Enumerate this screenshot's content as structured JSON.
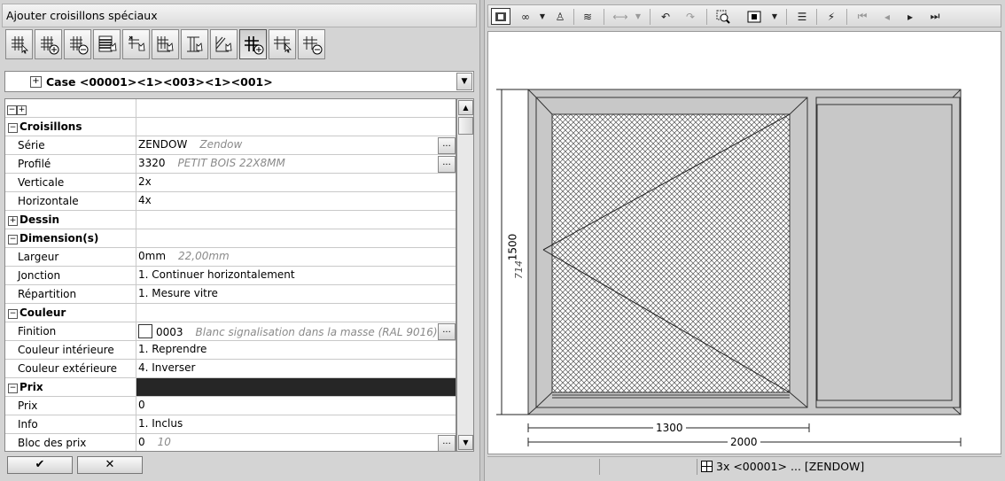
{
  "window_title": "Ajouter croisillons spéciaux",
  "case_label": "Case <00001><1><003><1><001>",
  "sections": {
    "croisillons": "Croisillons",
    "dessin": "Dessin",
    "dimensions": "Dimension(s)",
    "couleur": "Couleur",
    "prix": "Prix"
  },
  "props": {
    "serie": {
      "label": "Série",
      "value": "ZENDOW",
      "desc": "Zendow"
    },
    "profile": {
      "label": "Profilé",
      "value": "3320",
      "desc": "PETIT BOIS 22X8MM"
    },
    "verticale": {
      "label": "Verticale",
      "value": "2x"
    },
    "horizontale": {
      "label": "Horizontale",
      "value": "4x"
    },
    "largeur": {
      "label": "Largeur",
      "value": "0mm",
      "desc": "22,00mm"
    },
    "jonction": {
      "label": "Jonction",
      "value": "1. Continuer horizontalement"
    },
    "repartition": {
      "label": "Répartition",
      "value": "1. Mesure vitre"
    },
    "finition": {
      "label": "Finition",
      "value": "0003",
      "desc": "Blanc signalisation dans la masse (RAL 9016)"
    },
    "couleur_int": {
      "label": "Couleur intérieure",
      "value": "1. Reprendre"
    },
    "couleur_ext": {
      "label": "Couleur extérieure",
      "value": "4. Inverser"
    },
    "prix": {
      "label": "Prix",
      "value": "0"
    },
    "info": {
      "label": "Info",
      "value": "1. Inclus"
    },
    "bloc_prix": {
      "label": "Bloc des prix",
      "value": "0",
      "desc": "10"
    }
  },
  "buttons": {
    "ok": "✔",
    "cancel": "✕"
  },
  "drawing": {
    "dim_height": "1500",
    "dim_sub": "714",
    "dim_width_left": "1300",
    "dim_width_total": "2000"
  },
  "status_text": "3x <00001> ... [ZENDOW]",
  "colors": {
    "panel": "#d4d4d4",
    "frame_fill": "#c8c8c8",
    "prix_bar": "#262626"
  }
}
